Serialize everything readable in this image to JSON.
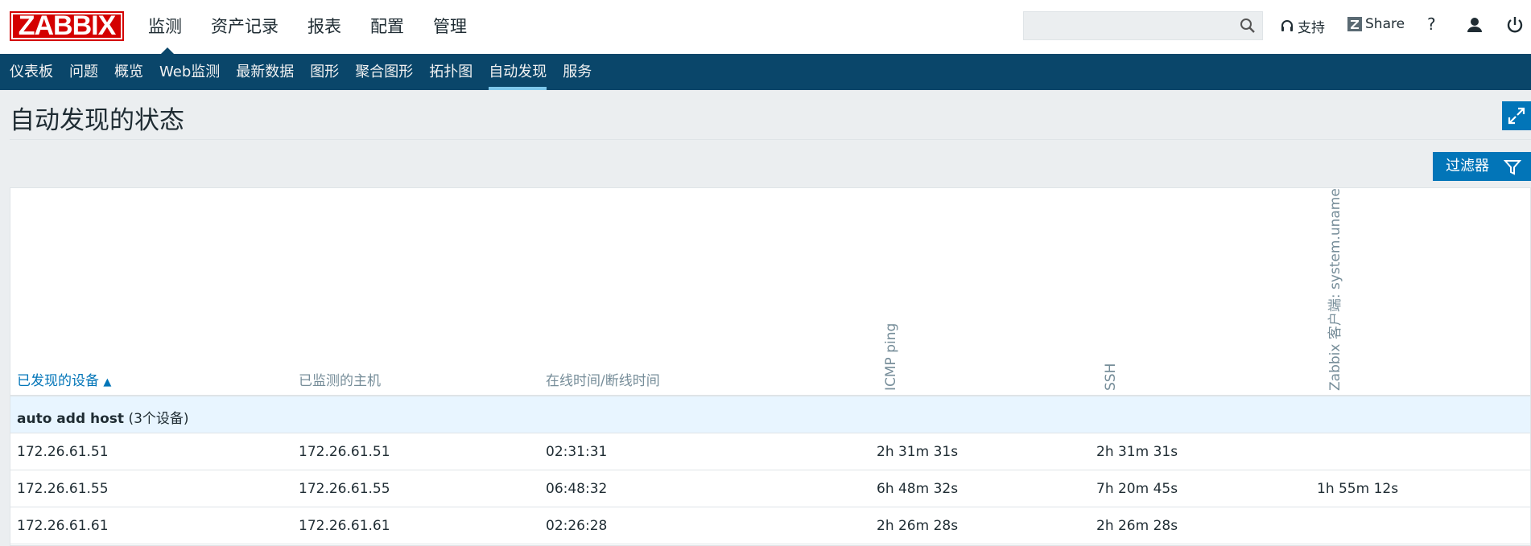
{
  "header": {
    "logo_text": "ZABBIX",
    "main_nav": [
      "监测",
      "资产记录",
      "报表",
      "配置",
      "管理"
    ],
    "active_main": 0,
    "search_value": "",
    "support_label": "支持",
    "share_label": "Share",
    "help_label": "?"
  },
  "sub_nav": {
    "items": [
      "仪表板",
      "问题",
      "概览",
      "Web监测",
      "最新数据",
      "图形",
      "聚合图形",
      "拓扑图",
      "自动发现",
      "服务"
    ],
    "active": 8
  },
  "page": {
    "title": "自动发现的状态",
    "filter_label": "过滤器"
  },
  "table": {
    "columns": {
      "device": "已发现的设备",
      "sort_arrow": "▲",
      "host": "已监测的主机",
      "uptime": "在线时间/断线时间",
      "icmp": "ICMP ping",
      "ssh": "SSH",
      "agent": "Zabbix 客户端: system.uname"
    },
    "group": {
      "name": "auto add host",
      "count": "(3个设备)"
    },
    "rows": [
      {
        "device": "172.26.61.51",
        "host": "172.26.61.51",
        "uptime": "02:31:31",
        "icmp": "2h 31m 31s",
        "ssh": "2h 31m 31s",
        "agent": ""
      },
      {
        "device": "172.26.61.55",
        "host": "172.26.61.55",
        "uptime": "06:48:32",
        "icmp": "6h 48m 32s",
        "ssh": "7h 20m 45s",
        "agent": "1h 55m 12s"
      },
      {
        "device": "172.26.61.61",
        "host": "172.26.61.61",
        "uptime": "02:26:28",
        "icmp": "2h 26m 28s",
        "ssh": "2h 26m 28s",
        "agent": ""
      }
    ]
  },
  "colors": {
    "brand_red": "#d40000",
    "nav_blue": "#0a466a",
    "accent_blue": "#0275b8",
    "group_bg": "#e8f5ff"
  }
}
